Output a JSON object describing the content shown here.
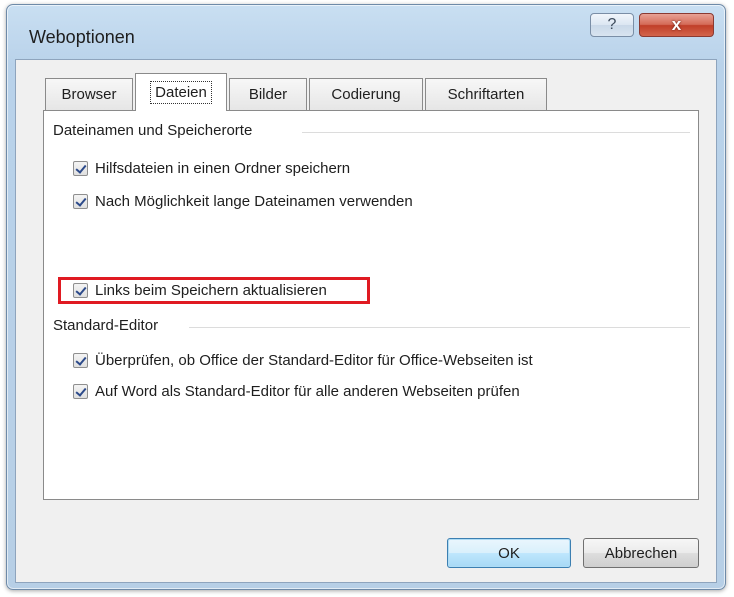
{
  "window": {
    "title": "Weboptionen",
    "help_icon": "?",
    "close_icon": "x"
  },
  "tabs": [
    {
      "label": "Browser",
      "active": false
    },
    {
      "label": "Dateien",
      "active": true
    },
    {
      "label": "Bilder",
      "active": false
    },
    {
      "label": "Codierung",
      "active": false
    },
    {
      "label": "Schriftarten",
      "active": false
    }
  ],
  "groups": {
    "files": {
      "header": "Dateinamen und Speicherorte",
      "options": [
        {
          "label": "Hilfsdateien in einen Ordner speichern",
          "checked": true
        },
        {
          "label": "Nach Möglichkeit lange Dateinamen verwenden",
          "checked": true
        },
        {
          "label": "Links beim Speichern aktualisieren",
          "checked": true,
          "highlighted": true
        }
      ]
    },
    "editor": {
      "header": "Standard-Editor",
      "options": [
        {
          "label": "Überprüfen, ob Office der Standard-Editor für Office-Webseiten ist",
          "checked": true
        },
        {
          "label": "Auf Word als Standard-Editor für alle anderen Webseiten prüfen",
          "checked": true
        }
      ]
    }
  },
  "buttons": {
    "ok": "OK",
    "cancel": "Abbrechen"
  },
  "colors": {
    "highlight": "#e01a22",
    "close_button": "#c03e28"
  }
}
